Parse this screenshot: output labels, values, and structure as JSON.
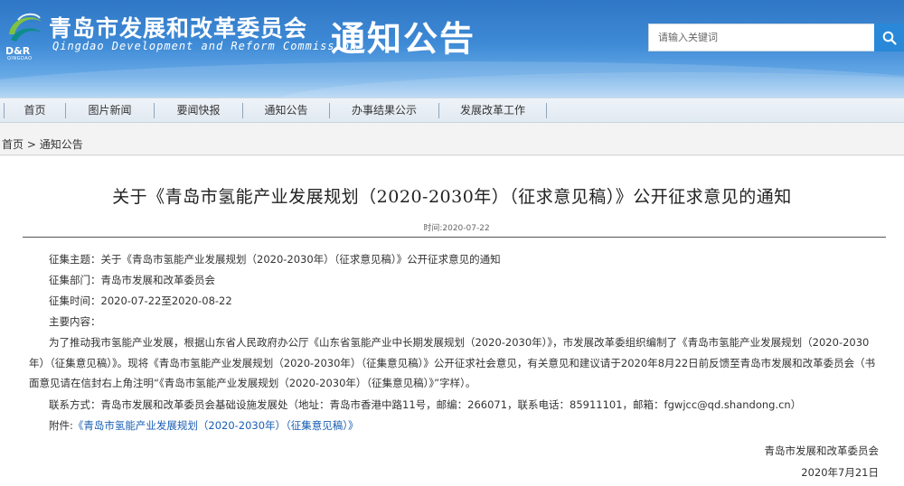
{
  "header": {
    "logo_text": "D&R",
    "logo_sub": "QINGDAO",
    "site_title": "青岛市发展和改革委员会",
    "site_eng": "Qingdao Development and Reform Commission",
    "section_title": "通知公告",
    "search_placeholder": "请输入关键词",
    "brand_color": "#2f77c6"
  },
  "nav": {
    "items": [
      "首页",
      "图片新闻",
      "要闻快报",
      "通知公告",
      "办事结果公示",
      "发展改革工作"
    ]
  },
  "breadcrumb": {
    "home": "首页",
    "separator": " > ",
    "current": "通知公告"
  },
  "article": {
    "title": "关于《青岛市氢能产业发展规划（2020-2030年）（征求意见稿）》公开征求意见的通知",
    "date": "时间:2020-07-22",
    "subject_label": "征集主题：",
    "subject": "关于《青岛市氢能产业发展规划（2020-2030年）（征求意见稿）》公开征求意见的通知",
    "dept_label": "征集部门：",
    "dept": "青岛市发展和改革委员会",
    "period_label": "征集时间：",
    "period": "2020-07-22至2020-08-22",
    "content_label": "主要内容：",
    "content": "为了推动我市氢能产业发展，根据山东省人民政府办公厅《山东省氢能产业中长期发展规划（2020-2030年）》，市发展改革委组织编制了《青岛市氢能产业发展规划（2020-2030年）（征集意见稿）》。现将《青岛市氢能产业发展规划（2020-2030年）（征集意见稿）》公开征求社会意见，有关意见和建议请于2020年8月22日前反馈至青岛市发展和改革委员会（书面意见请在信封右上角注明“《青岛市氢能产业发展规划（2020-2030年）（征集意见稿）》”字样）。",
    "contact_label": "联系方式：",
    "contact": "青岛市发展和改革委员会基础设施发展处（地址：青岛市香港中路11号，邮编：266071，联系电话：85911101，邮箱：fgwjcc@qd.shandong.cn）",
    "attach_label": "附件:",
    "attach_link": "《青岛市氢能产业发展规划（2020-2030年）（征集意见稿）》",
    "signature": "青岛市发展和改革委员会",
    "sign_date": "2020年7月21日"
  }
}
